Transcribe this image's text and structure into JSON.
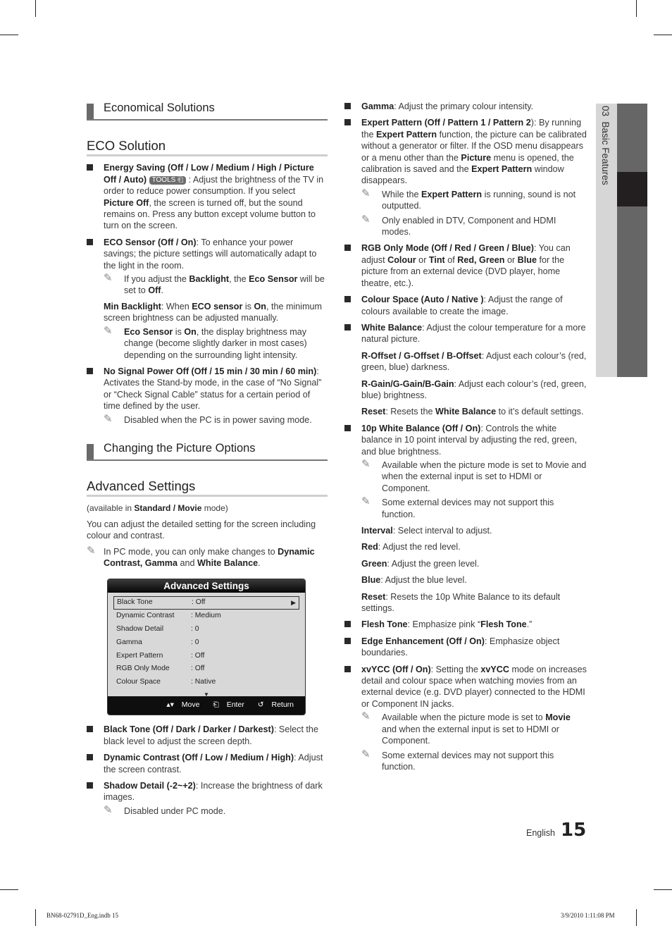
{
  "side_tab": {
    "chapter": "03",
    "label": "Basic Features"
  },
  "left": {
    "economical_heading": "Economical Solutions",
    "eco_title": "ECO Solution",
    "energy_saving": {
      "title": "Energy Saving (Off / Low / Medium / High / Picture Off / Auto)",
      "badge": "TOOLS",
      "text1": " : Adjust the brightness of the TV in order to reduce power consumption. If you select ",
      "bold1": "Picture Off",
      "text2": ", the screen is turned off, but the sound remains on. Press any button except volume button to turn on the screen."
    },
    "eco_sensor": {
      "title": "ECO Sensor (Off / On)",
      "text": ": To enhance your power savings; the picture settings will automatically adapt to the light in the room.",
      "note": {
        "t1": "If you adjust the ",
        "b1": "Backlight",
        "t2": ", the ",
        "b2": "Eco Sensor",
        "t3": " will be set to ",
        "b3": "Off",
        "t4": "."
      },
      "min_backlight": {
        "b1": "Min Backlight",
        "t1": ": When ",
        "b2": "ECO sensor",
        "t2": " is ",
        "b3": "On",
        "t3": ", the minimum screen brightness can be adjusted manually."
      },
      "note2": {
        "b1": "Eco Sensor",
        "t1": " is ",
        "b2": "On",
        "t2": ", the display brightness may change (become slightly darker in most cases) depending on the surrounding light intensity."
      }
    },
    "no_signal": {
      "title": "No Signal Power Off (Off / 15 min / 30 min / 60 min)",
      "text": ": Activates the Stand-by mode, in the case of “No Signal” or “Check Signal Cable” status for a certain period of time defined by the user.",
      "note": "Disabled when the PC is in power saving mode."
    },
    "picture_heading": "Changing the Picture Options",
    "advanced_title": "Advanced Settings",
    "available": {
      "t1": "(available in ",
      "b1": "Standard / Movie",
      "t2": " mode)"
    },
    "intro": "You can adjust the detailed setting for the screen including colour and contrast.",
    "pc_note": {
      "t1": "In PC mode, you can only make changes to ",
      "b1": "Dynamic Contrast, Gamma",
      "t2": " and ",
      "b2": "White Balance",
      "t3": "."
    },
    "osd": {
      "title": "Advanced Settings",
      "rows": [
        {
          "label": "Black Tone",
          "value": ": Off"
        },
        {
          "label": "Dynamic Contrast",
          "value": ": Medium"
        },
        {
          "label": "Shadow Detail",
          "value": ": 0"
        },
        {
          "label": "Gamma",
          "value": ": 0"
        },
        {
          "label": "Expert Pattern",
          "value": ": Off"
        },
        {
          "label": "RGB Only Mode",
          "value": ": Off"
        },
        {
          "label": "Colour Space",
          "value": ": Native"
        }
      ],
      "footer": {
        "move": "Move",
        "enter": "Enter",
        "return": "Return"
      }
    },
    "black_tone": {
      "title": "Black Tone (Off / Dark / Darker / Darkest)",
      "text": ": Select the black level to adjust the screen depth."
    },
    "dynamic_contrast": {
      "title": "Dynamic Contrast (Off / Low / Medium / High)",
      "text": ": Adjust the screen contrast."
    },
    "shadow_detail": {
      "title": "Shadow Detail (-2~+2)",
      "text": ": Increase the brightness of dark images.",
      "note": "Disabled under PC mode."
    }
  },
  "right": {
    "gamma": {
      "title": "Gamma",
      "text": ": Adjust the primary colour intensity."
    },
    "expert_pattern": {
      "title": "Expert Pattern (Off / Pattern 1 / Pattern 2",
      "t1": "): By running the ",
      "b1": "Expert Pattern",
      "t2": " function, the picture can be calibrated without a generator or filter. If the OSD menu disappears or a menu other than the ",
      "b2": "Picture",
      "t3": " menu is opened, the calibration is saved and the ",
      "b3": "Expert Pattern",
      "t4": " window disappears.",
      "note1": {
        "t1": "While the ",
        "b1": "Expert Pattern",
        "t2": " is running, sound is not outputted."
      },
      "note2": "Only enabled in DTV, Component and HDMI modes."
    },
    "rgb_only": {
      "title": "RGB Only Mode (Off / Red / Green / Blue)",
      "t1": ": You can adjust ",
      "b1": "Colour",
      "t2": " or ",
      "b2": "Tint",
      "t3": " of ",
      "b3": "Red, Green",
      "t4": " or ",
      "b4": "Blue",
      "t5": " for the picture from an external device (DVD player, home theatre, etc.)."
    },
    "colour_space": {
      "title": "Colour Space (Auto / Native )",
      "text": ": Adjust the range of colours available to create the image."
    },
    "white_balance": {
      "title": "White Balance",
      "text": ": Adjust the colour temperature for a more natural picture.",
      "offset": {
        "b": "R-Offset / G-Offset / B-Offset",
        "t": ": Adjust each colour’s (red, green, blue) darkness."
      },
      "gain": {
        "b": "R-Gain/G-Gain/B-Gain",
        "t": ": Adjust each colour’s (red, green, blue) brightness."
      },
      "reset": {
        "b1": "Reset",
        "t1": ": Resets the ",
        "b2": "White Balance",
        "t2": " to it’s default settings."
      }
    },
    "p10_white": {
      "title": "10p White Balance (Off / On)",
      "text": ": Controls the white balance in 10 point interval by adjusting the red, green, and blue brightness.",
      "note1": "Available when the picture mode is set to Movie and when the external input is set to HDMI or Component.",
      "note2": "Some external devices may not support this function.",
      "interval": {
        "b": "Interval",
        "t": ": Select interval to adjust."
      },
      "red": {
        "b": "Red",
        "t": ": Adjust the red level."
      },
      "green": {
        "b": "Green",
        "t": ": Adjust the green level."
      },
      "blue": {
        "b": "Blue",
        "t": ": Adjust the blue level."
      },
      "reset": {
        "b": "Reset",
        "t": ": Resets the 10p White Balance to its default settings."
      }
    },
    "flesh_tone": {
      "b1": "Flesh Tone",
      "t1": ": Emphasize pink “",
      "b2": "Flesh Tone",
      "t2": ".”"
    },
    "edge": {
      "title": "Edge Enhancement (Off / On)",
      "text": ": Emphasize object boundaries."
    },
    "xvycc": {
      "title": "xvYCC (Off / On)",
      "t1": ": Setting the ",
      "b1": "xvYCC",
      "t2": " mode on increases detail and colour space when watching movies from an external device (e.g. DVD player) connected to the HDMI or Component IN jacks.",
      "note1": {
        "t1": "Available when the picture mode is set to ",
        "b1": "Movie",
        "t2": " and when the external input is set to HDMI or Component."
      },
      "note2": "Some external devices may not support this function."
    }
  },
  "footer": {
    "language": "English",
    "page": "15"
  },
  "slug": {
    "file": "BN68-02791D_Eng.indb   15",
    "date": "3/9/2010   1:11:08 PM"
  }
}
